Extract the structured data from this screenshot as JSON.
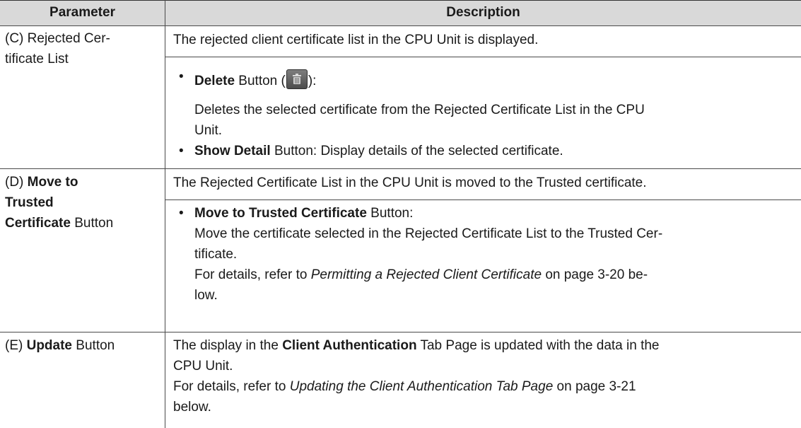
{
  "header": {
    "col1": "Parameter",
    "col2": "Description"
  },
  "rows": [
    {
      "param_line1": "(C) Rejected Cer-",
      "param_line2": "tificate List",
      "desc_top": "The rejected client certificate list in the CPU Unit is displayed.",
      "bullet": "•",
      "delete_bold": "Delete",
      "delete_rest": " Button (",
      "delete_close": "):",
      "delete_desc_line1": "Deletes the selected certificate from the Rejected Certificate List in the CPU",
      "delete_desc_line2": "Unit.",
      "show_bold": "Show Detail",
      "show_rest": " Button: Display details of the selected certificate."
    },
    {
      "param_prefix": "(D) ",
      "param_bold1": "Move to",
      "param_bold2": "Trusted",
      "param_bold3": "Certificate",
      "param_rest3": " Button",
      "desc_top": "The Rejected Certificate List in the CPU Unit is moved to the Trusted certificate.",
      "bullet": "•",
      "move_bold": "Move to Trusted Certificate",
      "move_rest": " Button:",
      "move_desc_line1": "Move the certificate selected in the Rejected Certificate List to the Trusted Cer-",
      "move_desc_line2": "tificate.",
      "ref_prefix": "For details, refer to ",
      "ref_italic": "Permitting a Rejected Client Certificate",
      "ref_suffix": " on page 3-20 be-",
      "ref_line2": "low."
    },
    {
      "param_prefix": "(E) ",
      "param_bold": "Update",
      "param_rest": " Button",
      "desc_prefix": "The display in the ",
      "desc_bold": "Client Authentication",
      "desc_suffix": " Tab Page is updated with the data in the",
      "desc_line2": "CPU Unit.",
      "ref_prefix": "For details, refer to ",
      "ref_italic": "Updating the Client Authentication Tab Page",
      "ref_suffix": " on page 3-21",
      "ref_line2": "below."
    }
  ],
  "icons": {
    "delete_button": "trash-icon"
  }
}
